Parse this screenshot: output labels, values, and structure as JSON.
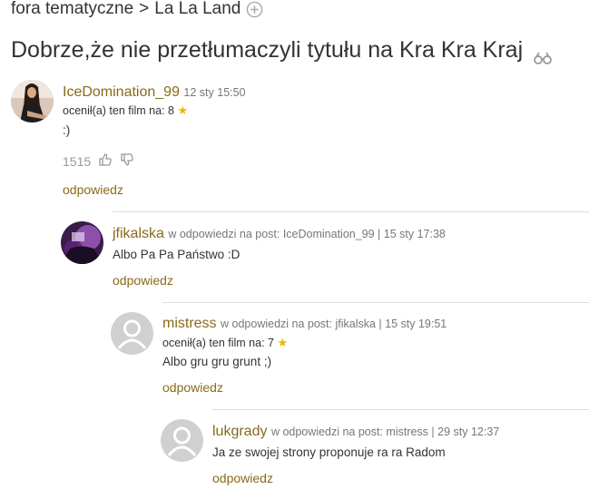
{
  "breadcrumb": {
    "section": "fora tematyczne",
    "separator": ">",
    "topic": "La La Land"
  },
  "thread": {
    "title": "Dobrze,że nie przetłumaczyli tytułu na Kra Kra Kraj"
  },
  "posts": [
    {
      "username": "IceDomination_99",
      "date": "12 sty 15:50",
      "rating_label": "ocenił(a) ten film na: 8",
      "text": ":)",
      "votes": "1515",
      "reply": "odpowiedz"
    },
    {
      "username": "jfikalska",
      "meta": "w odpowiedzi na post: IceDomination_99 | 15 sty 17:38",
      "text": "Albo Pa Pa Państwo :D",
      "reply": "odpowiedz"
    },
    {
      "username": "mistress",
      "meta": "w odpowiedzi na post: jfikalska | 15 sty 19:51",
      "rating_label": "ocenił(a) ten film na: 7",
      "text": "Albo gru gru grunt ;)",
      "reply": "odpowiedz"
    },
    {
      "username": "lukgrady",
      "meta": "w odpowiedzi na post: mistress | 29 sty 12:37",
      "text": "Ja ze swojej strony proponuje ra ra Radom",
      "reply": "odpowiedz"
    }
  ],
  "icons": {
    "star": "star-icon",
    "thumbs_up": "thumbs-up-icon",
    "thumbs_down": "thumbs-down-icon",
    "binoculars": "binoculars-icon",
    "plus": "plus-circle-icon"
  },
  "colors": {
    "username": "#8a6a1a",
    "star": "#f0b400",
    "meta": "#777777"
  }
}
